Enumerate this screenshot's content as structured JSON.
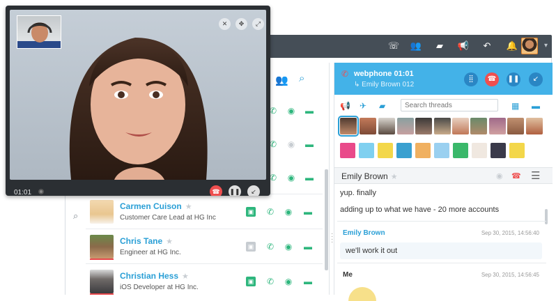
{
  "topbar": {
    "icons": [
      "call-forward-icon",
      "group-icon",
      "chat-icon",
      "megaphone-icon",
      "phone-return-icon",
      "bell-icon"
    ]
  },
  "video_call": {
    "duration": "01:01",
    "top_controls": [
      "mute-video-icon",
      "move-icon",
      "expand-icon"
    ],
    "bottom_controls": [
      "hangup-icon",
      "pause-icon",
      "minimize-icon"
    ]
  },
  "contacts": {
    "header_icons": [
      "add-user-icon",
      "search-icon"
    ],
    "rows": [
      {
        "name": "Carmen Cuison",
        "title": "Customer Care Lead",
        "at": "at",
        "company": "HG Inc",
        "online": true
      },
      {
        "name": "Chris Tane",
        "title": "Engineer",
        "at": "at",
        "company": "HG Inc.",
        "online": false
      },
      {
        "name": "Christian Hess",
        "title": "iOS Developer",
        "at": "at",
        "company": "HG Inc.",
        "online": true
      }
    ]
  },
  "webphone": {
    "title": "webphone 01:01",
    "subtitle": "Emily Brown 012",
    "accent": "#43b2e8",
    "hangup_color": "#ef4f4f"
  },
  "threads": {
    "search_placeholder": "Search threads"
  },
  "chat": {
    "contact_name": "Emily Brown",
    "messages": [
      {
        "text": "yup. finally"
      },
      {
        "text": "adding up to what we have - 20 more accounts"
      }
    ],
    "entries": [
      {
        "from": "Emily Brown",
        "time": "Sep 30, 2015, 14:56:40",
        "text": "we'll work it out"
      },
      {
        "from": "Me",
        "time": "Sep 30, 2015, 14:56:45"
      }
    ]
  }
}
